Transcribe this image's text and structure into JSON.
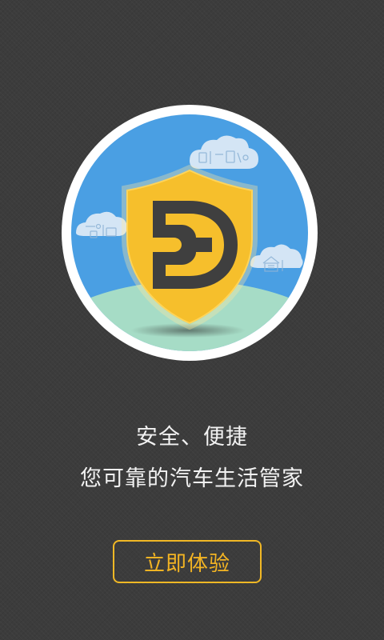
{
  "hero": {
    "logo_icon": "shield-wrench-logo",
    "colors": {
      "ring": "#ffffff",
      "sky": "#4a9fe3",
      "hill": "#a6dcc6",
      "shield": "#f6bf2c",
      "shield_edge": "#ffe07a",
      "mark": "#3f3f3f",
      "cloud": "#dbe9f5"
    },
    "cloud_icons": [
      "toolbox-cloud-icon",
      "tools-cloud-icon",
      "garage-cloud-icon"
    ]
  },
  "tagline": {
    "line1": "安全、便捷",
    "line2": "您可靠的汽车生活管家"
  },
  "cta": {
    "label": "立即体验",
    "color": "#f3b423"
  }
}
